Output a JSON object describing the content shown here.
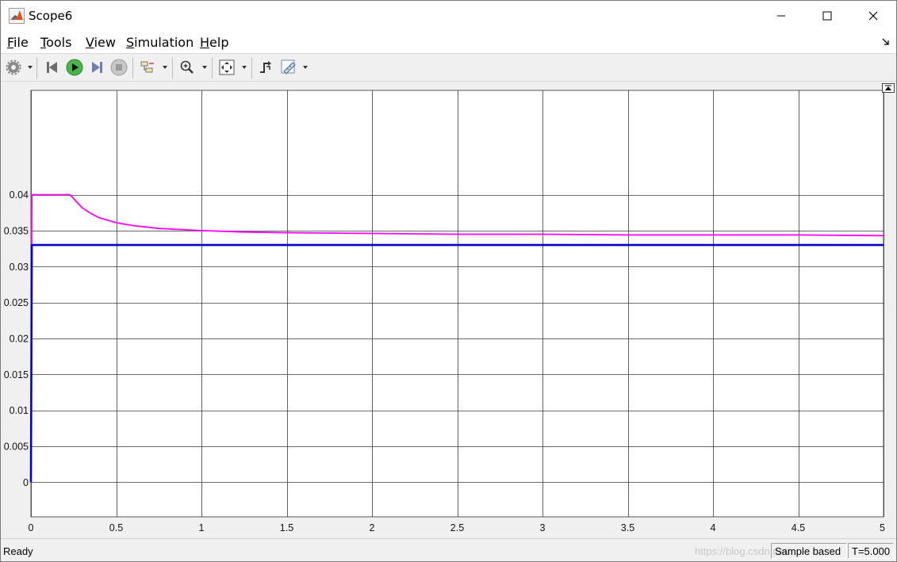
{
  "window": {
    "title": "Scope6"
  },
  "menu": [
    {
      "label": "File",
      "ul": "F",
      "rest": "ile"
    },
    {
      "label": "Tools",
      "ul": "T",
      "rest": "ools"
    },
    {
      "label": "View",
      "ul": "V",
      "rest": "iew"
    },
    {
      "label": "Simulation",
      "ul": "S",
      "rest": "imulation"
    },
    {
      "label": "Help",
      "ul": "H",
      "rest": "elp"
    }
  ],
  "toolbar": {
    "icons": [
      "gear-icon",
      "step-back-icon",
      "run-icon",
      "step-forward-icon",
      "stop-icon",
      "signal-selector-icon",
      "zoom-in-icon",
      "autoscale-icon",
      "trigger-icon",
      "measurement-icon"
    ]
  },
  "status": {
    "ready": "Ready",
    "sample_mode": "Sample based",
    "time": "T=5.000",
    "watermark": "https://blog.csdn.net/..."
  },
  "colors": {
    "plot_bg": "#ffffff",
    "grid": "#3a3a3a",
    "series1": "#ff00ff",
    "series2": "#0000cc"
  },
  "chart_data": {
    "type": "line",
    "title": "",
    "xlabel": "",
    "ylabel": "",
    "xlim": [
      0,
      5
    ],
    "ylim": [
      -0.0048,
      0.0545
    ],
    "x_ticks": [
      0,
      0.5,
      1,
      1.5,
      2,
      2.5,
      3,
      3.5,
      4,
      4.5,
      5
    ],
    "x_tick_labels": [
      "0",
      "0.5",
      "1",
      "1.5",
      "2",
      "2.5",
      "3",
      "3.5",
      "4",
      "4.5",
      "5"
    ],
    "y_ticks": [
      0,
      0.005,
      0.01,
      0.015,
      0.02,
      0.025,
      0.03,
      0.035,
      0.04
    ],
    "y_tick_labels": [
      "0",
      "0.005",
      "0.01",
      "0.015",
      "0.02",
      "0.025",
      "0.03",
      "0.035",
      "0.04"
    ],
    "grid": true,
    "series": [
      {
        "color": "#ff00ff",
        "x": [
          0,
          0.005,
          0.01,
          0.23,
          0.26,
          0.3,
          0.35,
          0.4,
          0.5,
          0.6,
          0.75,
          1.0,
          1.25,
          1.5,
          2.0,
          2.5,
          3.0,
          3.5,
          4.0,
          4.5,
          5.0
        ],
        "y": [
          0,
          0.04,
          0.04,
          0.04,
          0.0392,
          0.0382,
          0.0374,
          0.0368,
          0.0361,
          0.0357,
          0.0353,
          0.035,
          0.0348,
          0.0347,
          0.0346,
          0.0345,
          0.0345,
          0.0344,
          0.0344,
          0.0344,
          0.0343
        ]
      },
      {
        "color": "#0000cc",
        "x": [
          0,
          0.005,
          5.0
        ],
        "y": [
          0,
          0.033,
          0.033
        ]
      }
    ]
  }
}
